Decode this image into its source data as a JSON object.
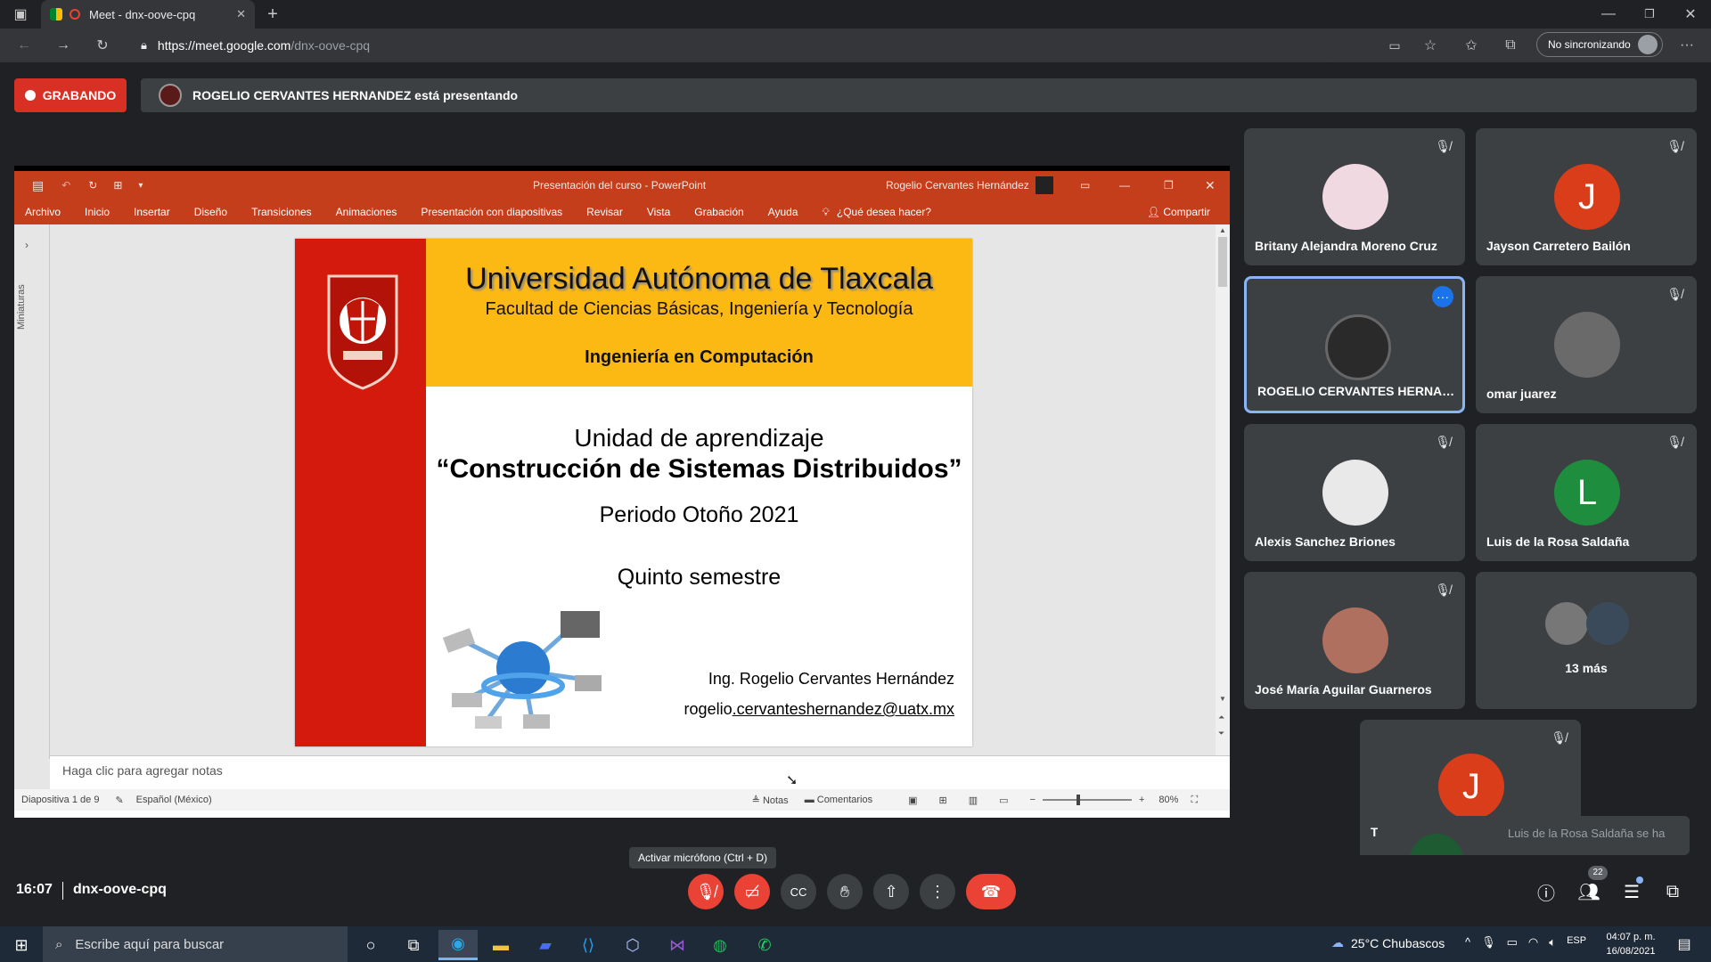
{
  "browser": {
    "tab_title": "Meet - dnx-oove-cpq",
    "url_host": "https://meet.google.com",
    "url_path": "/dnx-oove-cpq",
    "sync_label": "No sincronizando"
  },
  "meet": {
    "recording_label": "GRABANDO",
    "presenting_text": "ROGELIO CERVANTES HERNANDEZ está presentando",
    "time": "16:07",
    "meeting_code": "dnx-oove-cpq",
    "tooltip": "Activar micrófono (Ctrl + D)",
    "people_count": "22",
    "toast": "Luis de la Rosa Saldaña se ha"
  },
  "participants": [
    {
      "name": "Britany Alejandra Moreno Cruz",
      "initial": "",
      "color": "#f0d9e0"
    },
    {
      "name": "Jayson Carretero Bailón",
      "initial": "J",
      "color": "#d93d1a"
    },
    {
      "name": "ROGELIO CERVANTES HERNAN...",
      "initial": "",
      "color": "#2a2a2a"
    },
    {
      "name": "omar juarez",
      "initial": "",
      "color": "#6a6a6a"
    },
    {
      "name": "Alexis Sanchez Briones",
      "initial": "",
      "color": "#e9e9e9"
    },
    {
      "name": "Luis de la Rosa Saldaña",
      "initial": "L",
      "color": "#1e8e3e"
    },
    {
      "name": "José María Aguilar Guarneros",
      "initial": "",
      "color": "#b07060"
    },
    {
      "name": "13 más",
      "initial": "",
      "color": "#555"
    },
    {
      "name": "Tú",
      "initial": "J",
      "color": "#d93d1a"
    }
  ],
  "ppt": {
    "window_title": "Presentación del curso  -  PowerPoint",
    "user": "Rogelio Cervantes Hernández",
    "ribbon": [
      "Archivo",
      "Inicio",
      "Insertar",
      "Diseño",
      "Transiciones",
      "Animaciones",
      "Presentación con diapositivas",
      "Revisar",
      "Vista",
      "Grabación",
      "Ayuda"
    ],
    "tell_me": "¿Qué desea hacer?",
    "share": "Compartir",
    "thumbs_label": "Miniaturas",
    "notes_placeholder": "Haga clic para agregar notas",
    "status_slide": "Diapositiva 1 de 9",
    "status_lang": "Español (México)",
    "status_notes": "Notas",
    "status_comments": "Comentarios",
    "zoom": "80%"
  },
  "slide": {
    "university": "Universidad Autónoma de Tlaxcala",
    "faculty": "Facultad de Ciencias Básicas, Ingeniería y Tecnología",
    "program": "Ingeniería en Computación",
    "unit_label": "Unidad de aprendizaje",
    "course": "“Construcción de Sistemas Distribuidos”",
    "period": "Periodo Otoño 2021",
    "semester": "Quinto semestre",
    "teacher": "Ing. Rogelio Cervantes Hernández",
    "email_prefix": "rogelio",
    "email_rest": ".cervanteshernandez@uatx.mx"
  },
  "taskbar": {
    "search_placeholder": "Escribe aquí para buscar",
    "weather": "25°C  Chubascos",
    "lang": "ESP",
    "clock_time": "04:07 p. m.",
    "clock_date": "16/08/2021"
  }
}
